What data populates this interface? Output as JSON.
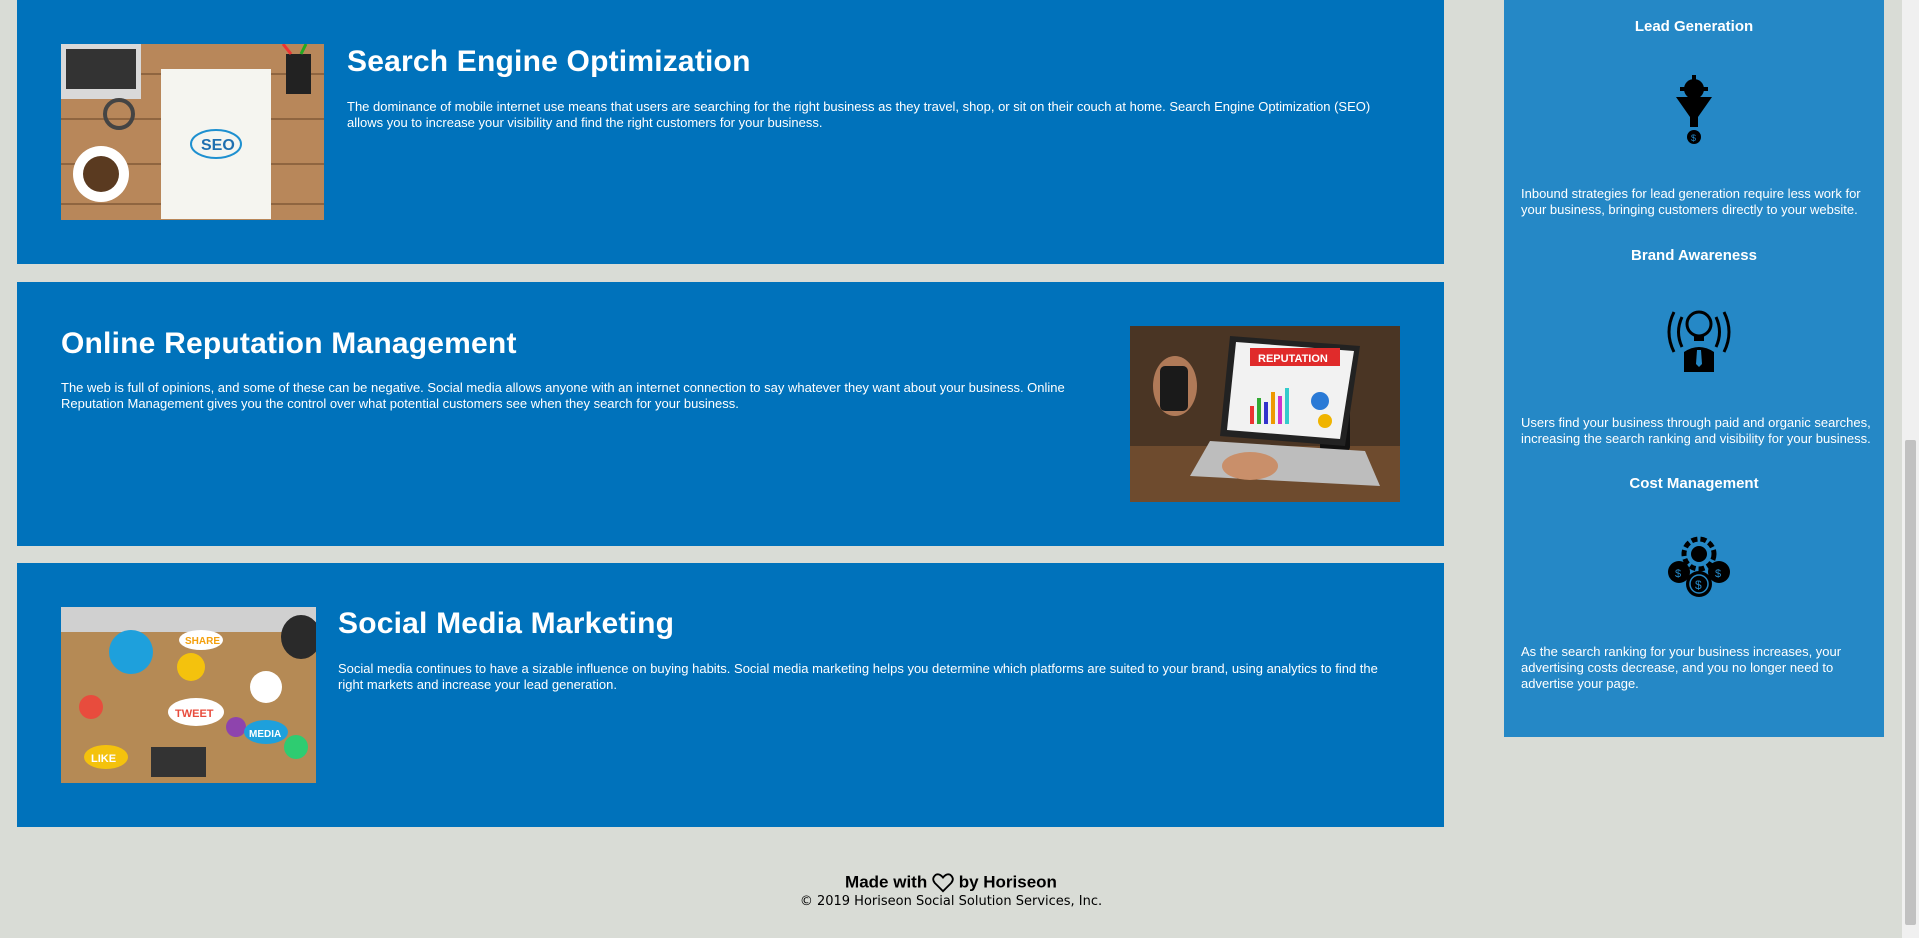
{
  "sections": [
    {
      "title": "Search Engine Optimization",
      "text": "The dominance of mobile internet use means that users are searching for the right business as they travel, shop, or sit on their couch at home. Search Engine Optimization (SEO) allows you to increase your visibility and find the right customers for your business.",
      "image_label": "SEO"
    },
    {
      "title": "Online Reputation Management",
      "text": "The web is full of opinions, and some of these can be negative. Social media allows anyone with an internet connection to say whatever they want about your business. Online Reputation Management gives you the control over what potential customers see when they search for your business.",
      "image_label": "REPUTATION"
    },
    {
      "title": "Social Media Marketing",
      "text": "Social media continues to have a sizable influence on buying habits. Social media marketing helps you determine which platforms are suited to your brand, using analytics to find the right markets and increase your lead generation.",
      "image_bubbles": [
        "SHARE",
        "TWEET",
        "LIKE",
        "MEDIA"
      ]
    }
  ],
  "sidebar": {
    "items": [
      {
        "title": "Lead Generation",
        "text": "Inbound strategies for lead generation require less work for your business, bringing customers directly to your website.",
        "icon": "lead-generation-funnel-icon"
      },
      {
        "title": "Brand Awareness",
        "text": "Users find your business through paid and organic searches, increasing the search ranking and visibility for your business.",
        "icon": "brand-awareness-bulb-icon"
      },
      {
        "title": "Cost Management",
        "text": "As the search ranking for your business increases, your advertising costs decrease, and you no longer need to advertise your page.",
        "icon": "cost-management-coins-icon"
      }
    ]
  },
  "footer": {
    "made_with": "Made with",
    "by": "by Horiseon",
    "copyright": "© 2019 Horiseon Social Solution Services, Inc."
  },
  "colors": {
    "card": "#0072bb",
    "sidebar": "#2588c6",
    "page_bg": "#d9dcd6"
  }
}
